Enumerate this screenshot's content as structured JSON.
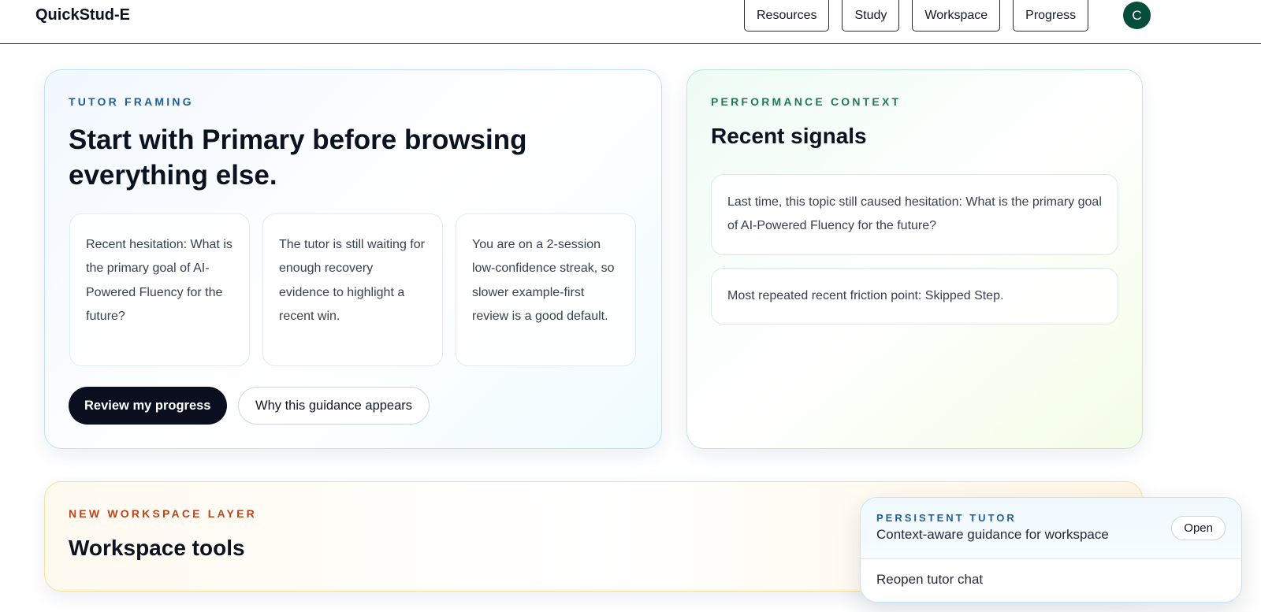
{
  "header": {
    "brand": "QuickStud-E",
    "nav": [
      "Resources",
      "Study",
      "Workspace",
      "Progress"
    ],
    "avatar_initial": "C"
  },
  "tutor_card": {
    "eyebrow": "TUTOR FRAMING",
    "title": "Start with Primary before browsing everything else.",
    "tiles": [
      "Recent hesitation: What is the primary goal of AI-Powered Fluency for the future?",
      "The tutor is still waiting for enough recovery evidence to highlight a recent win.",
      "You are on a 2-session low-confidence streak, so slower example-first review is a good default."
    ],
    "primary_button": "Review my progress",
    "secondary_button": "Why this guidance appears"
  },
  "performance_card": {
    "eyebrow": "PERFORMANCE CONTEXT",
    "title": "Recent signals",
    "signals": [
      "Last time, this topic still caused hesitation: What is the primary goal of AI-Powered Fluency for the future?",
      "Most repeated recent friction point: Skipped Step."
    ]
  },
  "workspace_card": {
    "eyebrow": "NEW WORKSPACE LAYER",
    "title": "Workspace tools"
  },
  "tutor_popup": {
    "eyebrow": "PERSISTENT TUTOR",
    "subtitle": "Context-aware guidance for workspace",
    "open_button": "Open",
    "reopen_link": "Reopen tutor chat"
  },
  "colors": {
    "brand_dark": "#0a0f1f",
    "avatar": "#064e3b",
    "eyebrow_blue": "#1d5f9a",
    "eyebrow_green": "#1e7a5a",
    "eyebrow_orange": "#b8461a"
  }
}
